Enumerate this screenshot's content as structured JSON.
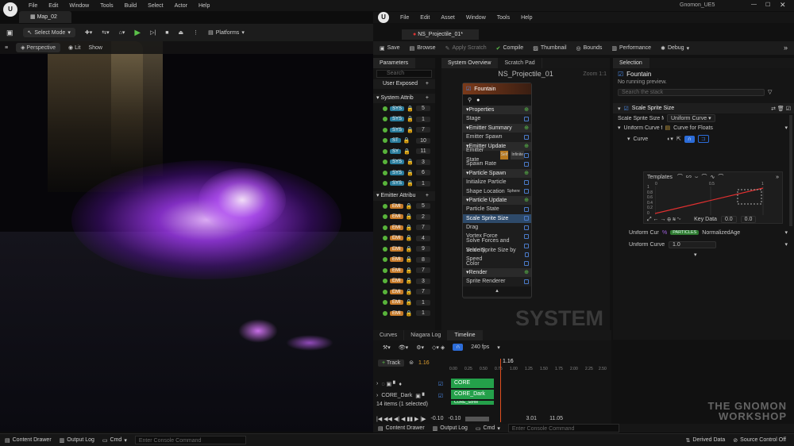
{
  "main": {
    "map_tab": "Map_02",
    "menu": [
      "File",
      "Edit",
      "Window",
      "Tools",
      "Build",
      "Select",
      "Actor",
      "Help"
    ],
    "project": "Gnomon_UE5",
    "select_mode": "Select Mode",
    "platforms": "Platforms",
    "viewport": {
      "perspective": "Perspective",
      "lit": "Lit",
      "show": "Show"
    }
  },
  "niagara": {
    "menu": [
      "File",
      "Edit",
      "Asset",
      "Window",
      "Tools",
      "Help"
    ],
    "asset_tab": "NS_Projectile_01*",
    "toolbar": [
      "Save",
      "Browse",
      "Apply Scratch",
      "Compile",
      "Thumbnail",
      "Bounds",
      "Performance",
      "Debug"
    ],
    "tabs": {
      "parameters": "Parameters",
      "system_overview": "System Overview",
      "scratch_pad": "Scratch Pad",
      "selection": "Selection"
    },
    "search_placeholder": "Search",
    "user_exposed": "User Exposed",
    "system_attributes": "System Attrib",
    "emitter_attributes": "Emitter Attribu",
    "sys_values": [
      "5",
      "1",
      "7",
      "10",
      "11",
      "3",
      "6",
      "1"
    ],
    "sys_tags": [
      "SYS",
      "SYS",
      "SYS",
      "ST",
      "SY",
      "SYS",
      "SYS",
      "SYS"
    ],
    "emt_values": [
      "5",
      "2",
      "7",
      "4",
      "9",
      "8",
      "7",
      "3",
      "7",
      "1",
      "1"
    ],
    "emt_tag": "EMI",
    "graph_title": "NS_Projectile_01",
    "zoom": "Zoom 1:1",
    "watermark": "SYSTEM",
    "node": {
      "title": "Fountain",
      "items": [
        {
          "t": "hdr",
          "l": "Properties"
        },
        {
          "t": "row",
          "l": "Stage"
        },
        {
          "t": "hdr",
          "l": "Emitter Summary"
        },
        {
          "t": "row",
          "l": "Emitter Spawn"
        },
        {
          "t": "hdr",
          "l": "Emitter Update"
        },
        {
          "t": "row",
          "l": "Emitter State"
        },
        {
          "t": "row",
          "l": "Spawn Rate"
        },
        {
          "t": "hdr",
          "l": "Particle Spawn"
        },
        {
          "t": "row",
          "l": "Initialize Particle"
        },
        {
          "t": "row",
          "l": "Shape Location"
        },
        {
          "t": "hdr",
          "l": "Particle Update"
        },
        {
          "t": "row",
          "l": "Particle State"
        },
        {
          "t": "sel",
          "l": "Scale Sprite Size"
        },
        {
          "t": "row",
          "l": "Drag"
        },
        {
          "t": "row",
          "l": "Vortex Force"
        },
        {
          "t": "row",
          "l": "Solve Forces and Velocity"
        },
        {
          "t": "row",
          "l": "Scale Sprite Size by Speed"
        },
        {
          "t": "row",
          "l": "Color"
        },
        {
          "t": "hdr",
          "l": "Render"
        },
        {
          "t": "row",
          "l": "Sprite Renderer"
        }
      ],
      "tag_self": "Self",
      "tag_infinite": "Infinite",
      "tag_sphere": "Sphere"
    },
    "selection": {
      "title": "Fountain",
      "subtitle": "No running preview.",
      "search_placeholder": "Search the stack",
      "module": "Scale Sprite Size",
      "mode_label": "Scale Sprite Size M",
      "mode_value": "Uniform Curve",
      "uniform_curve_label": "Uniform Curve f",
      "uniform_curve_value": "Curve for Floats",
      "curve_label": "Curve",
      "templates": "Templates",
      "key_data": "Key Data",
      "key_a": "0.0",
      "key_b": "0.0",
      "y_ticks": [
        "1",
        "0.8",
        "0.6",
        "0.4",
        "0.2",
        "0"
      ],
      "x_ticks": [
        "0",
        "0.5",
        "1"
      ],
      "particles_tag": "PARTICLES",
      "normalized_age": "NormalizedAge",
      "scale_label": "Uniform Curve S",
      "scale_value": "1.0"
    },
    "bottom": {
      "tabs": [
        "Curves",
        "Niagara Log",
        "Timeline"
      ],
      "fps": "240 fps",
      "track": "Track",
      "time": "1.16",
      "ruler": [
        "0.00",
        "0.25",
        "0.50",
        "0.75",
        "1.00",
        "1.25",
        "1.50",
        "1.75",
        "2.00",
        "2.25",
        "2.50"
      ],
      "tracks": [
        "CORE",
        "CORE_Dark"
      ],
      "clips": [
        "CORE",
        "CORE_Dark",
        "CORE_Scroll"
      ],
      "count": "14 items (1 selected)",
      "range": [
        "-0.10",
        "-0.10",
        "3.01",
        "11.05"
      ]
    }
  },
  "status": {
    "content_drawer": "Content Drawer",
    "output_log": "Output Log",
    "cmd": "Cmd",
    "console_placeholder": "Enter Console Command",
    "derived_data": "Derived Data",
    "source_control": "Source Control Off"
  },
  "watermark": "THE GNOMON WORKSHOP"
}
